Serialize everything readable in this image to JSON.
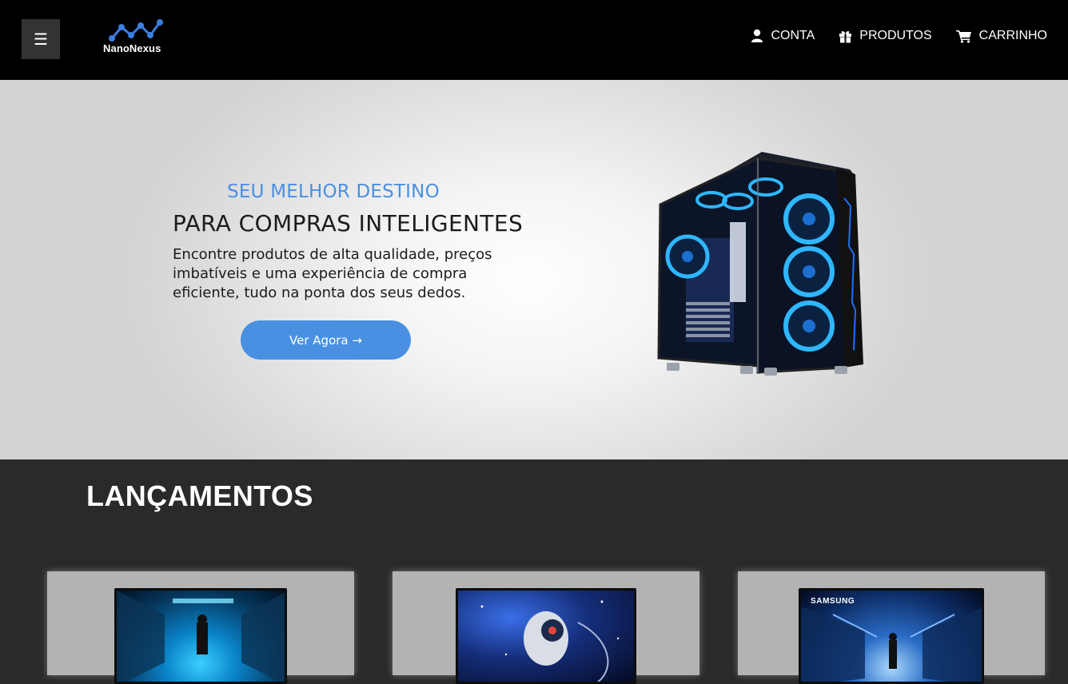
{
  "header": {
    "menu_icon": "menu-icon",
    "brand_name": "NanoNexus",
    "nav": [
      {
        "label": "CONTA",
        "icon": "user-icon"
      },
      {
        "label": "PRODUTOS",
        "icon": "gift-icon"
      },
      {
        "label": "CARRINHO",
        "icon": "cart-icon"
      }
    ]
  },
  "hero": {
    "eyebrow": "SEU MELHOR DESTINO",
    "title": "PARA COMPRAS INTELIGENTES",
    "description": "Encontre produtos de alta qualidade, preços imbatíveis e uma experiência de compra eficiente, tudo na ponta dos seus dedos.",
    "cta_label": "Ver Agora →"
  },
  "releases": {
    "title": "LANÇAMENTOS",
    "cards": [
      {
        "brand": ""
      },
      {
        "brand": ""
      },
      {
        "brand": "SAMSUNG"
      }
    ]
  },
  "colors": {
    "accent": "#4a90e2",
    "header_bg": "#000000",
    "section_bg": "#2a2a2a",
    "card_bg": "#b3b3b3"
  }
}
